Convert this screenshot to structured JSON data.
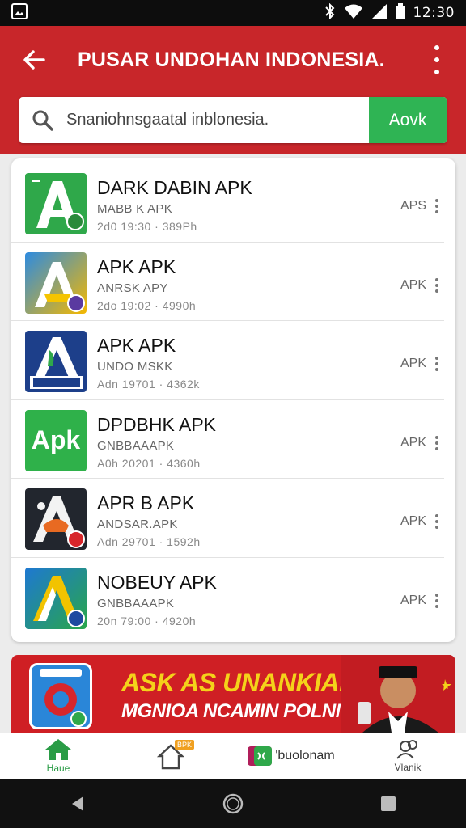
{
  "status_bar": {
    "time": "12:30",
    "icons": [
      "image-icon",
      "bluetooth-icon",
      "wifi-icon",
      "signal-icon",
      "battery-icon"
    ]
  },
  "app_bar": {
    "title": "PUSAR UNDOHAN INDONESIA.",
    "background_color": "#c8262a"
  },
  "search": {
    "value": "Snaniohnsgaatal inblonesia.",
    "placeholder": "",
    "button_label": "Aovk",
    "button_color": "#2fb454"
  },
  "apps": [
    {
      "title": "DARK DABIN APK",
      "subtitle": "MABB K APK",
      "meta": "2d0 19:30 · 389Ph",
      "tag": "APS",
      "icon": "apk-a-green-icon"
    },
    {
      "title": "APK APK",
      "subtitle": "ANRSK APY",
      "meta": "2do 19:02 · 4990h",
      "tag": "APK",
      "icon": "apk-a-yellow-icon"
    },
    {
      "title": "APK APK",
      "subtitle": "UNDO MSKK",
      "meta": "Adn 19701 · 4362k",
      "tag": "APK",
      "icon": "apk-a-navy-icon"
    },
    {
      "title": "DPDBHK APK",
      "subtitle": "GNBBAAAPK",
      "meta": "A0h 20201 · 4360h",
      "tag": "APK",
      "icon": "apk-text-green-icon"
    },
    {
      "title": "APR B APK",
      "subtitle": "ANDSAR.APK",
      "meta": "Adn 29701 · 1592h",
      "tag": "APK",
      "icon": "apk-a-dark-icon"
    },
    {
      "title": "NOBEUY APK",
      "subtitle": "GNBBAAAPK",
      "meta": "20n 79:00 · 4920h",
      "tag": "APK",
      "icon": "apk-a-blue-icon"
    }
  ],
  "apk_tile_text": "Apk",
  "banner": {
    "line1": "ASK AS UNANKIANM",
    "line2": "MGNIOA NCAMIN POLNMIN",
    "line1_color": "#f4d21a"
  },
  "bottom_nav": {
    "home_label": "Haue",
    "home_badge": "BPK",
    "mid_label": "'buolonam",
    "right_label": "Vlanik"
  }
}
